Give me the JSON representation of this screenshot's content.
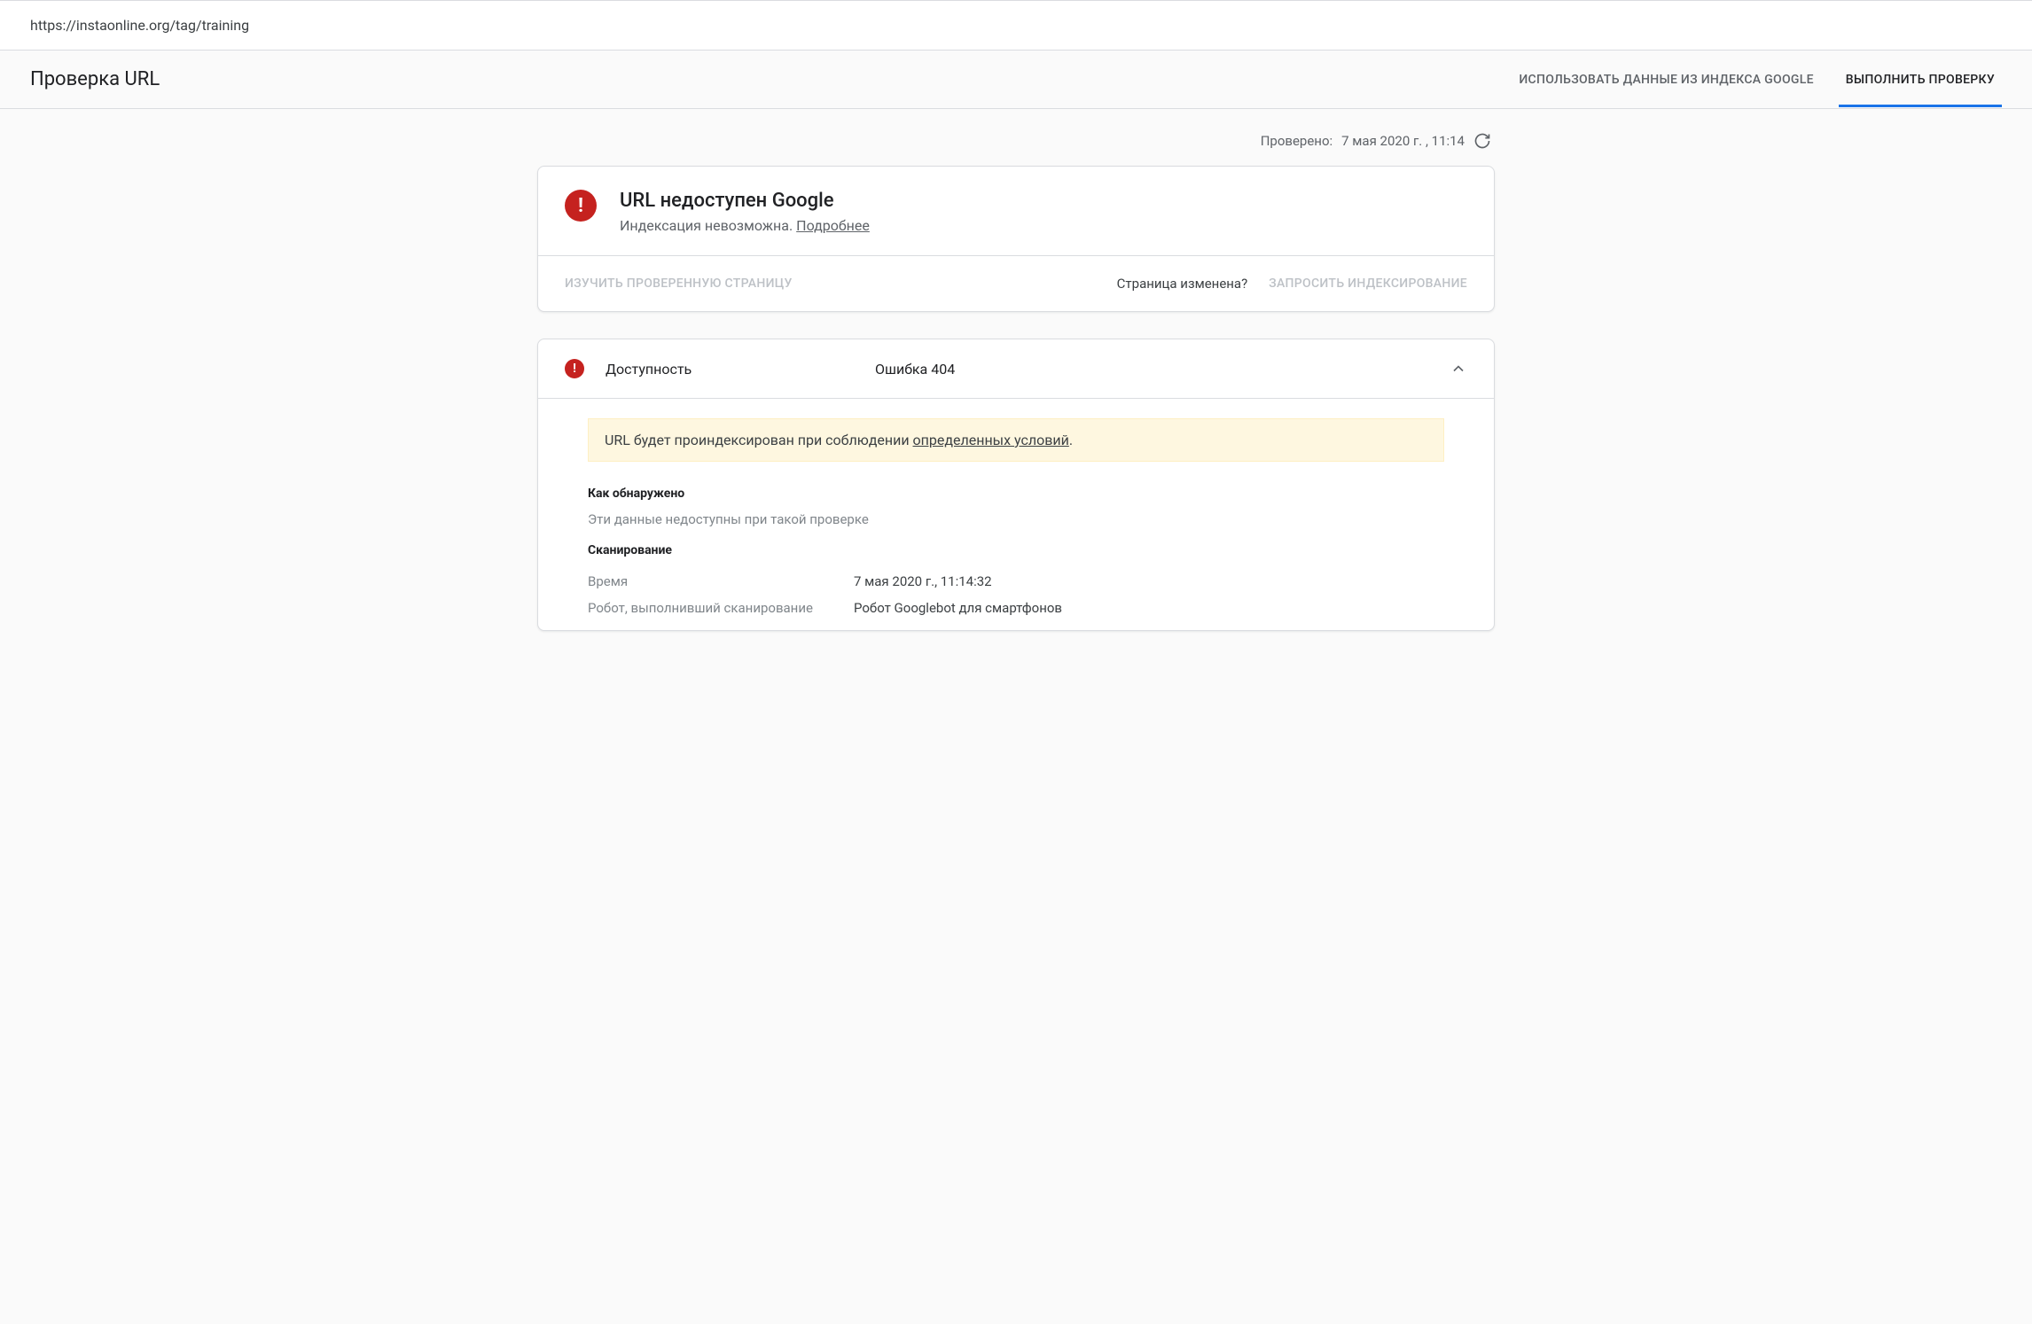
{
  "url_bar": {
    "value": "https://instaonline.org/tag/training"
  },
  "header": {
    "title": "Проверка URL",
    "tabs": [
      {
        "label": "ИСПОЛЬЗОВАТЬ ДАННЫЕ ИЗ ИНДЕКСА GOOGLE",
        "active": false
      },
      {
        "label": "ВЫПОЛНИТЬ ПРОВЕРКУ",
        "active": true
      }
    ]
  },
  "checked": {
    "prefix": "Проверено:",
    "timestamp": "7 мая 2020 г. , 11:14"
  },
  "status_card": {
    "title": "URL недоступен Google",
    "subtitle_text": "Индексация невозможна.",
    "subtitle_link": "Подробнее",
    "actions": {
      "view_tested": "ИЗУЧИТЬ ПРОВЕРЕННУЮ СТРАНИЦУ",
      "changed_q": "Страница изменена?",
      "request_index": "ЗАПРОСИТЬ ИНДЕКСИРОВАНИЕ"
    }
  },
  "access_section": {
    "label": "Доступность",
    "value": "Ошибка 404",
    "notice_text": "URL будет проиндексирован при соблюдении ",
    "notice_link": "определенных условий",
    "notice_tail": ".",
    "discovery": {
      "heading": "Как обнаружено",
      "body": "Эти данные недоступны при такой проверке"
    },
    "crawl": {
      "heading": "Сканирование",
      "rows": [
        {
          "k": "Время",
          "v": "7 мая 2020 г., 11:14:32"
        },
        {
          "k": "Робот, выполнивший сканирование",
          "v": "Робот Googlebot для смартфонов"
        }
      ]
    }
  }
}
